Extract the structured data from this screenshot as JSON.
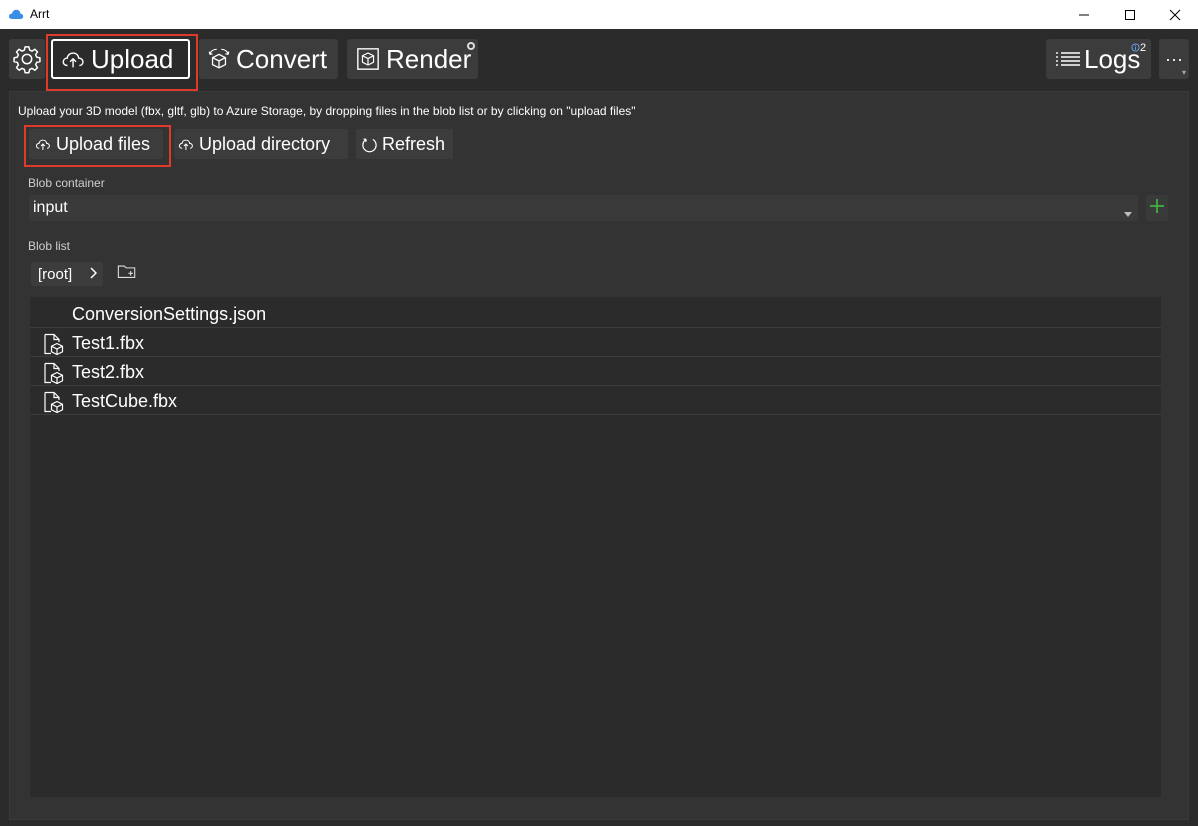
{
  "window": {
    "title": "Arrt"
  },
  "toolbar": {
    "upload_label": "Upload",
    "convert_label": "Convert",
    "render_label": "Render",
    "logs_label": "Logs",
    "logs_count": "2",
    "more_label": "···"
  },
  "upload_page": {
    "description": "Upload your 3D model (fbx, gltf, glb) to Azure Storage, by dropping files in the blob list or by clicking on \"upload files\"",
    "upload_files_label": "Upload files",
    "upload_directory_label": "Upload directory",
    "refresh_label": "Refresh",
    "blob_container_label": "Blob container",
    "blob_container_value": "input",
    "blob_list_label": "Blob list",
    "root_crumb": "[root]",
    "files": [
      {
        "name": "ConversionSettings.json",
        "icon": "none"
      },
      {
        "name": "Test1.fbx",
        "icon": "model-file-icon"
      },
      {
        "name": "Test2.fbx",
        "icon": "model-file-icon"
      },
      {
        "name": "TestCube.fbx",
        "icon": "model-file-icon"
      }
    ]
  },
  "colors": {
    "highlight_box": "#e03a2a",
    "add_icon": "#3fbf3f",
    "logs_badge": "#6aa8ff"
  }
}
